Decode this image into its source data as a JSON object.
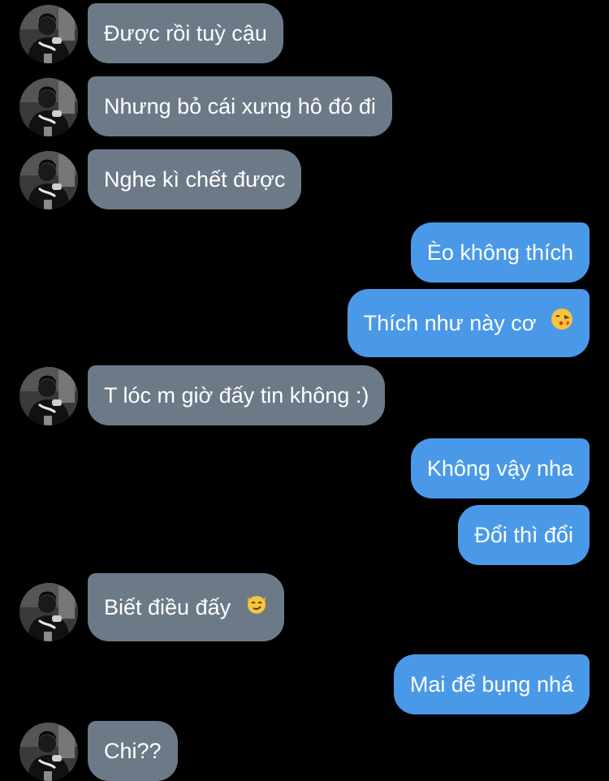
{
  "conversation": {
    "messages": [
      {
        "sender": "them",
        "text": "Được rồi tuỳ cậu"
      },
      {
        "sender": "them",
        "text": "Nhưng bỏ cái xưng hô đó đi"
      },
      {
        "sender": "them",
        "text": "Nghe kì chết được"
      },
      {
        "sender": "me",
        "text": "Èo không thích"
      },
      {
        "sender": "me",
        "text": "Thích như này cơ",
        "emoji": "kissing-face-emoji"
      },
      {
        "sender": "them",
        "text": "T lóc m giờ đấy tin không :)"
      },
      {
        "sender": "me",
        "text": "Không vậy nha"
      },
      {
        "sender": "me",
        "text": "Đổi thì đổi"
      },
      {
        "sender": "them",
        "text": "Biết điều đấy",
        "emoji": "smirking-cat-emoji"
      },
      {
        "sender": "me",
        "text": "Mai để bụng nhá"
      },
      {
        "sender": "them",
        "text": "Chi??"
      }
    ]
  },
  "colors": {
    "background": "#000000",
    "incoming_bubble": "#6c7a88",
    "outgoing_bubble": "#4a99e9",
    "text": "#ffffff"
  }
}
